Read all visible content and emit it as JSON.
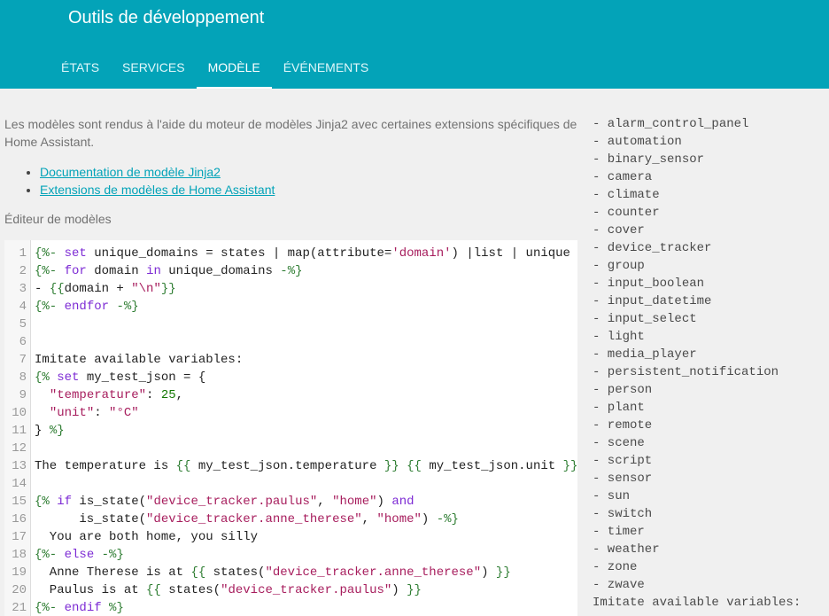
{
  "header": {
    "title": "Outils de développement",
    "tabs": [
      "États",
      "Services",
      "Modèle",
      "Événements"
    ],
    "active_tab": "Modèle"
  },
  "main": {
    "description": "Les modèles sont rendus à l'aide du moteur de modèles Jinja2 avec certaines extensions spécifiques de Home Assistant.",
    "links": [
      "Documentation de modèle Jinja2",
      "Extensions de modèles de Home Assistant"
    ],
    "editor_label": "Éditeur de modèles"
  },
  "editor": {
    "line_numbers": [
      "1",
      "2",
      "3",
      "4",
      "5",
      "6",
      "7",
      "8",
      "9",
      "10",
      "11",
      "12",
      "13",
      "14",
      "15",
      "16",
      "17",
      "18",
      "19",
      "20",
      "21"
    ],
    "lines": [
      "{%- set unique_domains = states | map(attribute='domain') |list | unique",
      "{%- for domain in unique_domains -%}",
      "- {{domain + \"\\n\"}}",
      "{%- endfor -%}",
      "",
      "",
      "Imitate available variables:",
      "{% set my_test_json = {",
      "  \"temperature\": 25,",
      "  \"unit\": \"°C\"",
      "} %}",
      "",
      "The temperature is {{ my_test_json.temperature }} {{ my_test_json.unit }}",
      "",
      "{% if is_state(\"device_tracker.paulus\", \"home\") and",
      "      is_state(\"device_tracker.anne_therese\", \"home\") -%}",
      "  You are both home, you silly",
      "{%- else -%}",
      "  Anne Therese is at {{ states(\"device_tracker.anne_therese\") }}",
      "  Paulus is at {{ states(\"device_tracker.paulus\") }}",
      "{%- endif %}"
    ]
  },
  "result": {
    "lines": [
      "- alarm_control_panel",
      "- automation",
      "- binary_sensor",
      "- camera",
      "- climate",
      "- counter",
      "- cover",
      "- device_tracker",
      "- group",
      "- input_boolean",
      "- input_datetime",
      "- input_select",
      "- light",
      "- media_player",
      "- persistent_notification",
      "- person",
      "- plant",
      "- remote",
      "- scene",
      "- script",
      "- sensor",
      "- sun",
      "- switch",
      "- timer",
      "- weather",
      "- zone",
      "- zwave",
      "Imitate available variables:"
    ]
  },
  "colors": {
    "header": "#03a3b8",
    "link": "#03a3b8",
    "keyword": "#7d2bd4",
    "string": "#a71d5d",
    "number": "#117700"
  }
}
